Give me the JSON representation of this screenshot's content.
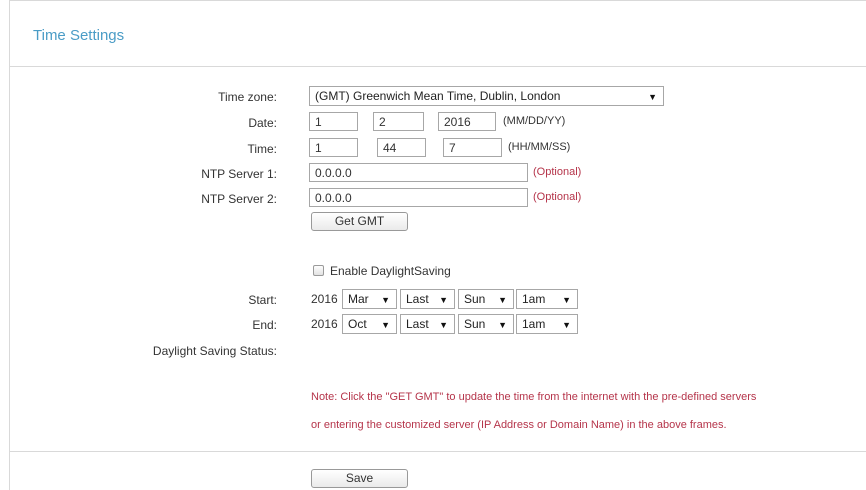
{
  "page": {
    "title": "Time Settings"
  },
  "time_zone": {
    "label": "Time zone:",
    "value": "(GMT) Greenwich Mean Time, Dublin, London"
  },
  "date": {
    "label": "Date:",
    "month": "1",
    "day": "2",
    "year": "2016",
    "hint": "(MM/DD/YY)"
  },
  "time": {
    "label": "Time:",
    "hour": "1",
    "minute": "44",
    "second": "7",
    "hint": "(HH/MM/SS)"
  },
  "ntp1": {
    "label": "NTP Server 1:",
    "value": "0.0.0.0",
    "optional": "(Optional)"
  },
  "ntp2": {
    "label": "NTP Server 2:",
    "value": "0.0.0.0",
    "optional": "(Optional)"
  },
  "get_gmt_label": "Get GMT",
  "daylight": {
    "enable_label": "Enable DaylightSaving",
    "enabled": false,
    "start": {
      "label": "Start:",
      "year": "2016",
      "month": "Mar",
      "week": "Last",
      "day": "Sun",
      "hour": "1am"
    },
    "end": {
      "label": "End:",
      "year": "2016",
      "month": "Oct",
      "week": "Last",
      "day": "Sun",
      "hour": "1am"
    },
    "status_label": "Daylight Saving Status:"
  },
  "note": {
    "line1": "Note: Click the \"GET GMT\" to update the time from the internet with the pre-defined servers",
    "line2": "or entering the customized server (IP Address or Domain Name) in the above frames."
  },
  "save_label": "Save",
  "icons": {
    "dropdown": "▼"
  },
  "colors": {
    "title": "#4a9cc6",
    "optional_text": "#b5344a",
    "note_text": "#b5344a"
  }
}
